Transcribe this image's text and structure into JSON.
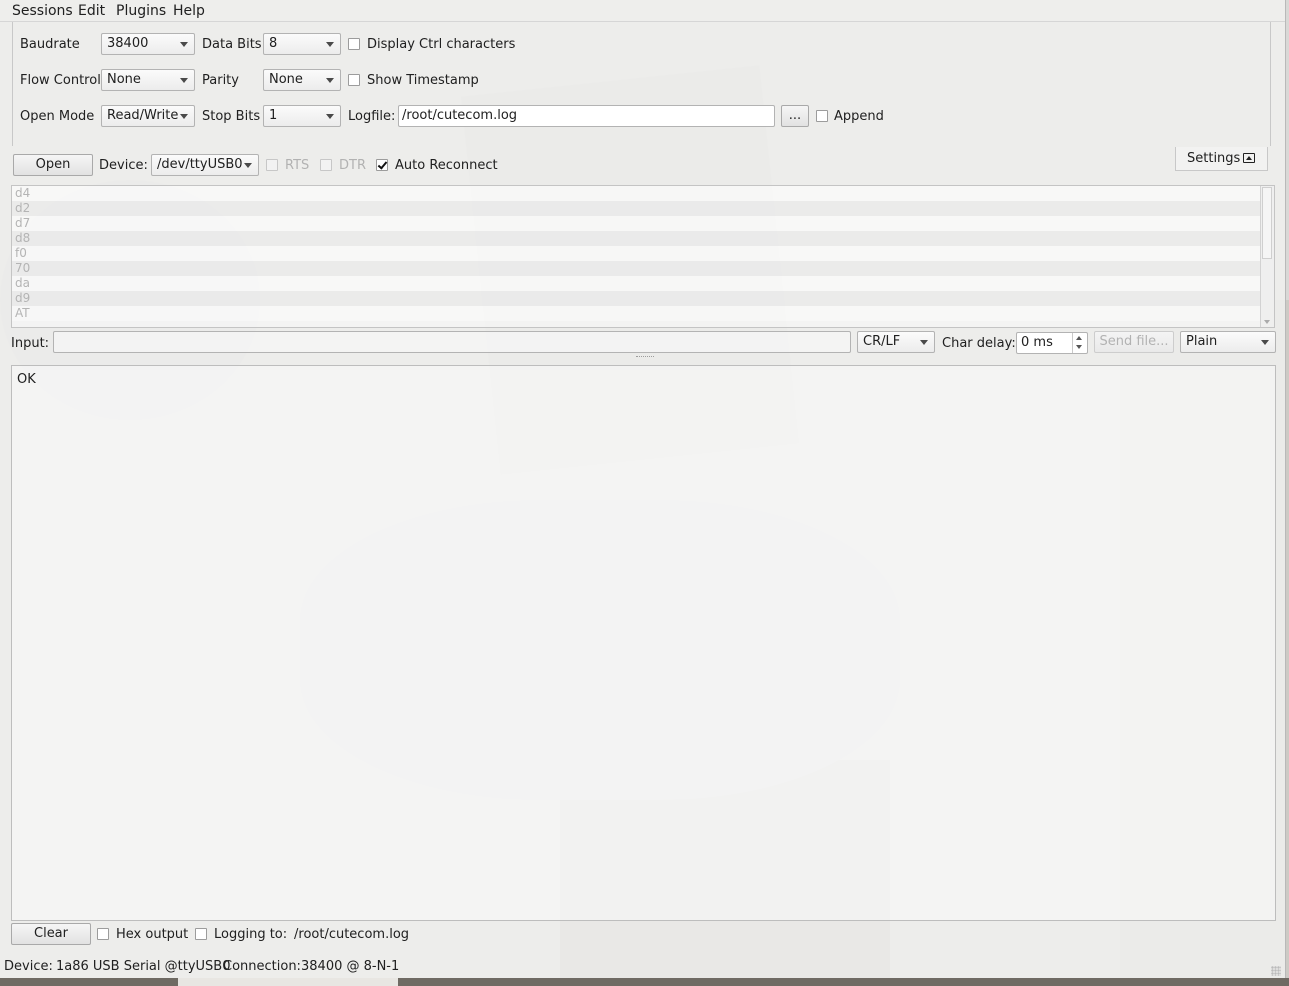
{
  "menu": {
    "sessions": "Sessions",
    "edit": "Edit",
    "plugins": "Plugins",
    "help": "Help"
  },
  "settings": {
    "baudrate_label": "Baudrate",
    "baudrate_value": "38400",
    "data_bits_label": "Data Bits",
    "data_bits_value": "8",
    "display_ctrl_label": "Display Ctrl characters",
    "display_ctrl_checked": false,
    "flow_control_label": "Flow Control",
    "flow_control_value": "None",
    "parity_label": "Parity",
    "parity_value": "None",
    "show_timestamp_label": "Show Timestamp",
    "show_timestamp_checked": false,
    "open_mode_label": "Open Mode",
    "open_mode_value": "Read/Write",
    "stop_bits_label": "Stop Bits",
    "stop_bits_value": "1",
    "logfile_label": "Logfile:",
    "logfile_value": "/root/cutecom.log",
    "browse_label": "...",
    "append_label": "Append",
    "append_checked": false
  },
  "connection": {
    "open_label": "Open",
    "device_label": "Device:",
    "device_value": "/dev/ttyUSB0",
    "rts_label": "RTS",
    "dtr_label": "DTR",
    "auto_reconnect_label": "Auto Reconnect",
    "auto_reconnect_checked": true,
    "settings_tab_label": "Settings",
    "settings_tab_icon": "collapse-panel-icon"
  },
  "history": [
    "d4",
    "d2",
    "d7",
    "d8",
    "f0",
    "70",
    "da",
    "d9",
    "AT"
  ],
  "input_bar": {
    "input_label": "Input:",
    "input_value": "",
    "line_end_value": "CR/LF",
    "char_delay_label": "Char delay:",
    "char_delay_value": "0 ms",
    "send_file_label": "Send file...",
    "format_value": "Plain"
  },
  "output": {
    "text": "OK"
  },
  "output_bar": {
    "clear_label": "Clear",
    "hex_output_label": "Hex output",
    "hex_output_checked": false,
    "logging_to_label": "Logging to:",
    "logging_to_value": "/root/cutecom.log",
    "logging_checked": false
  },
  "statusbar": {
    "device_label": "Device:",
    "device_value": "1a86 USB Serial @ttyUSB0",
    "connection_label": "Connection:",
    "connection_value": "38400 @ 8-N-1"
  }
}
